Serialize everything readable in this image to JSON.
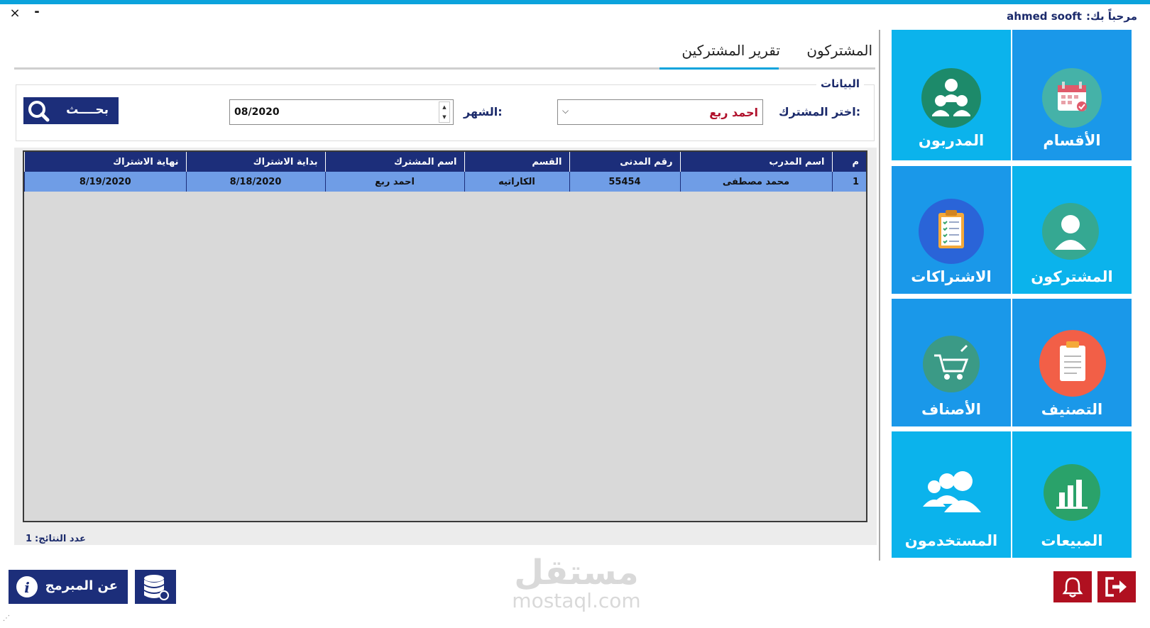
{
  "window": {
    "close_glyph": "×",
    "minimize_glyph": "-",
    "welcome_prefix": "مرحباً بك:",
    "username": "ahmed sooft",
    "accent_color": "#0ba3dc"
  },
  "tiles": [
    {
      "label": "الأقسام",
      "icon": "calendar-icon"
    },
    {
      "label": "المدربون",
      "icon": "trainers-group-icon"
    },
    {
      "label": "المشتركون",
      "icon": "user-icon"
    },
    {
      "label": "الاشتراكات",
      "icon": "clipboard-checklist-icon"
    },
    {
      "label": "التصنيف",
      "icon": "document-icon"
    },
    {
      "label": "الأصناف",
      "icon": "shopping-cart-icon"
    },
    {
      "label": "المبيعات",
      "icon": "bar-chart-icon"
    },
    {
      "label": "المستخدمون",
      "icon": "users-icon"
    }
  ],
  "tabs": [
    {
      "label": "المشتركون",
      "active": false
    },
    {
      "label": "تقرير المشتركين",
      "active": true
    }
  ],
  "filters": {
    "group_title": "البيانات",
    "subscriber_label": "اختر المشترك:",
    "subscriber_value": "احمد ربع",
    "month_label": "الشهر:",
    "month_value": "08/2020",
    "search_label": "بحــــث"
  },
  "table": {
    "columns": [
      "م",
      "اسم المدرب",
      "رقم المدنى",
      "القسم",
      "اسم المشترك",
      "بداية الاشتراك",
      "نهاية الاشتراك"
    ],
    "rows": [
      [
        "1",
        "محمد مصطفى",
        "55454",
        "الكاراتيه",
        "احمد ربع",
        "8/18/2020",
        "8/19/2020"
      ]
    ]
  },
  "footer": {
    "count_label": "عدد النتائج:",
    "count_value": "1",
    "about_label": "عن المبرمج"
  },
  "watermark": {
    "arabic": "مستقل",
    "latin": "mostaql.com"
  }
}
